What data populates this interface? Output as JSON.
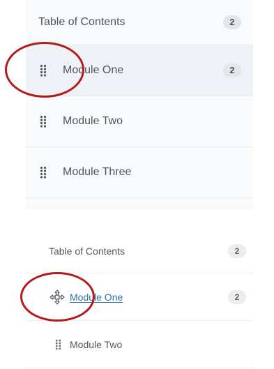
{
  "top_panel": {
    "header": {
      "title": "Table of Contents",
      "count": "2"
    },
    "items": [
      {
        "label": "Module One",
        "count": "2",
        "selected": true
      },
      {
        "label": "Module Two"
      },
      {
        "label": "Module Three"
      }
    ]
  },
  "bottom_panel": {
    "header": {
      "title": "Table of Contents",
      "count": "2"
    },
    "items": [
      {
        "label": "Module One",
        "count": "2",
        "dragging": true
      },
      {
        "label": "Module Two"
      }
    ]
  },
  "icons": {
    "drag_handle": "drag-handle-icon",
    "move": "move-arrows-icon"
  },
  "colors": {
    "annotation": "#b31b1b",
    "link": "#2f6fa8",
    "selected_row": "#eef1f5"
  }
}
